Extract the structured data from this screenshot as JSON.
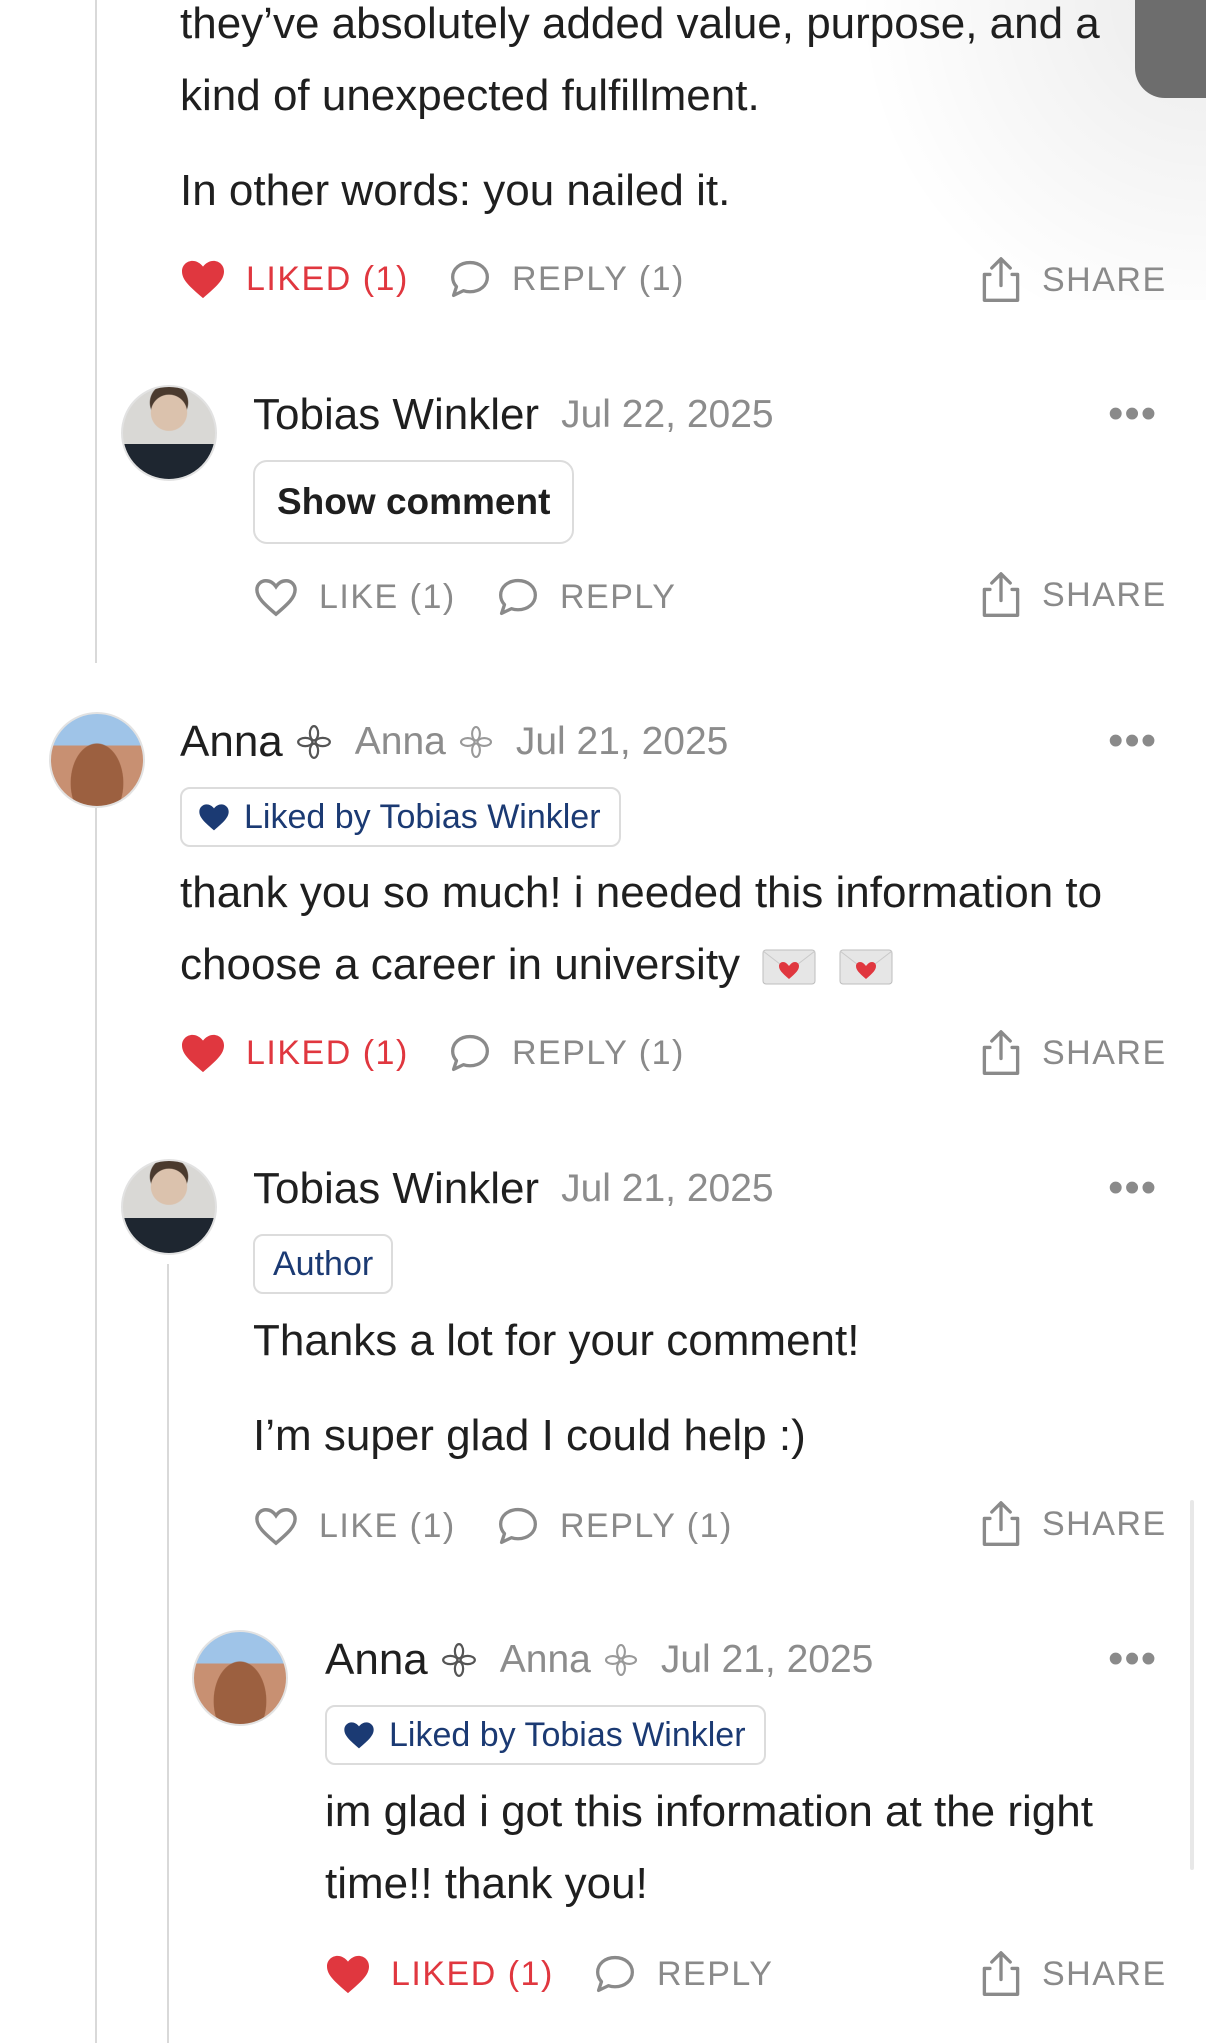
{
  "colors": {
    "liked": "#e0373f",
    "navy": "#1b3a73",
    "muted": "#8a8a8a",
    "thread_line": "#d9d9d9"
  },
  "icons": {
    "heart": "heart-icon",
    "comment": "comment-bubble-icon",
    "share": "share-icon",
    "more": "more-icon",
    "flower": "flower-badge-icon",
    "envelope": "love-letter-icon"
  },
  "top_comment": {
    "lines": [
      "they’ve absolutely added value, purpose, and a",
      "kind of unexpected fulfillment."
    ],
    "closing": "In other words: you nailed it.",
    "like_label": "LIKED (1)",
    "reply_label": "REPLY (1)",
    "share_label": "SHARE"
  },
  "reply_hidden": {
    "author": "Tobias Winkler",
    "date": "Jul 22, 2025",
    "more": "•••",
    "show_comment_label": "Show comment",
    "like_label": "LIKE (1)",
    "reply_label": "REPLY",
    "share_label": "SHARE"
  },
  "comment_anna": {
    "author": "Anna",
    "handle": "Anna",
    "date": "Jul 21, 2025",
    "more": "•••",
    "liked_by": "Liked by Tobias Winkler",
    "lines": [
      "thank you so much! i needed this information to",
      "choose a career in university"
    ],
    "like_label": "LIKED (1)",
    "reply_label": "REPLY (1)",
    "share_label": "SHARE"
  },
  "reply_tobias": {
    "author": "Tobias Winkler",
    "date": "Jul 21, 2025",
    "more": "•••",
    "badge": "Author",
    "line1": "Thanks a lot for your comment!",
    "line2": "I’m super glad I could help :)",
    "like_label": "LIKE (1)",
    "reply_label": "REPLY (1)",
    "share_label": "SHARE"
  },
  "reply_anna": {
    "author": "Anna",
    "handle": "Anna",
    "date": "Jul 21, 2025",
    "more": "•••",
    "liked_by": "Liked by Tobias Winkler",
    "lines": [
      "im glad i got this information at the right",
      "time!! thank you!"
    ],
    "like_label": "LIKED (1)",
    "reply_label": "REPLY",
    "share_label": "SHARE"
  }
}
